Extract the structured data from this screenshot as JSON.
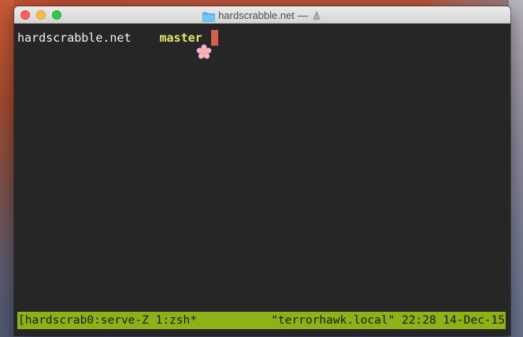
{
  "window": {
    "title": "hardscrabble.net",
    "title_separator": "—",
    "folder_icon": "folder-icon",
    "shell_icon": "shell-icon"
  },
  "terminal": {
    "prompt": {
      "directory": "hardscrabble.net",
      "flower_icon": "cherry-blossom-icon",
      "branch": "master"
    },
    "colors": {
      "background": "#262626",
      "prompt_text": "#f2f2f2",
      "branch_text": "#e6e86a",
      "cursor": "#d3604f"
    }
  },
  "statusbar": {
    "left": "[hardscrab0:serve-Z 1:zsh*",
    "right": "\"terrorhawk.local\" 22:28 14-Dec-15",
    "background": "#8fb118"
  }
}
